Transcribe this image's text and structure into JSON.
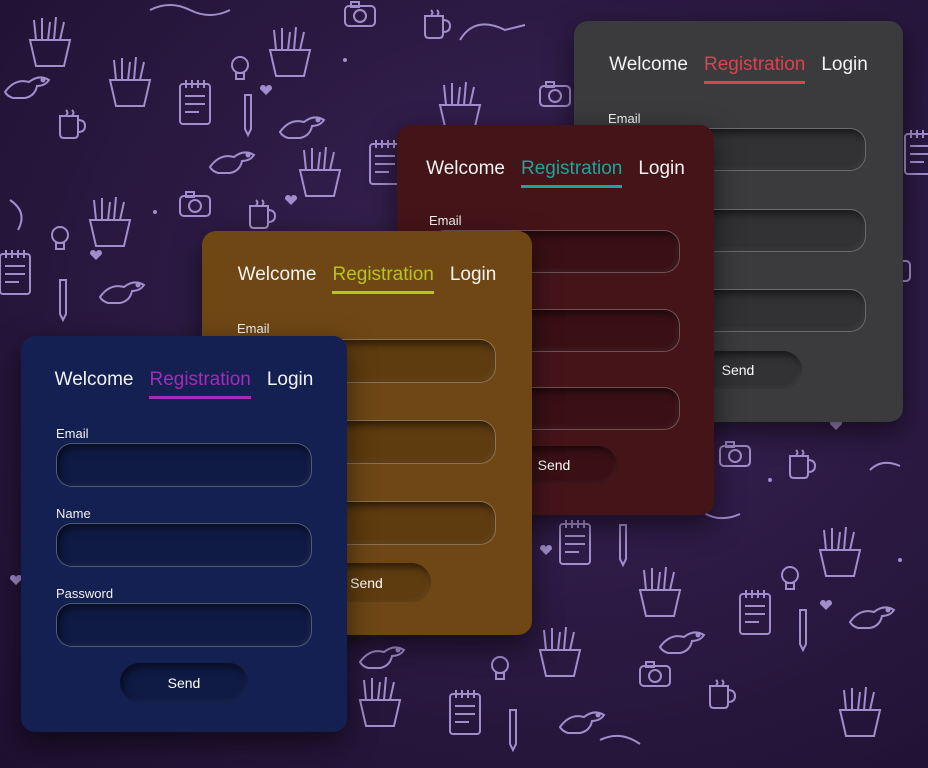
{
  "colors": {
    "gray_card": "#3b3a3d",
    "maroon_card": "#451419",
    "brown_card": "#6e4715",
    "navy_card": "#142051",
    "gray_accent": "#e0404f",
    "maroon_accent": "#17a89a",
    "brown_accent": "#b7c51e",
    "navy_accent": "#a52bb9"
  },
  "cards": {
    "gray": {
      "tabs": [
        "Welcome",
        "Registration",
        "Login"
      ],
      "email_label": "Email",
      "send_label": "Send"
    },
    "maroon": {
      "tabs": [
        "Welcome",
        "Registration",
        "Login"
      ],
      "email_label": "Email",
      "send_label": "Send"
    },
    "brown": {
      "tabs": [
        "Welcome",
        "Registration",
        "Login"
      ],
      "email_label": "Email",
      "send_label": "Send"
    },
    "navy": {
      "tabs": [
        "Welcome",
        "Registration",
        "Login"
      ],
      "email_label": "Email",
      "name_label": "Name",
      "password_label": "Password",
      "send_label": "Send"
    }
  }
}
